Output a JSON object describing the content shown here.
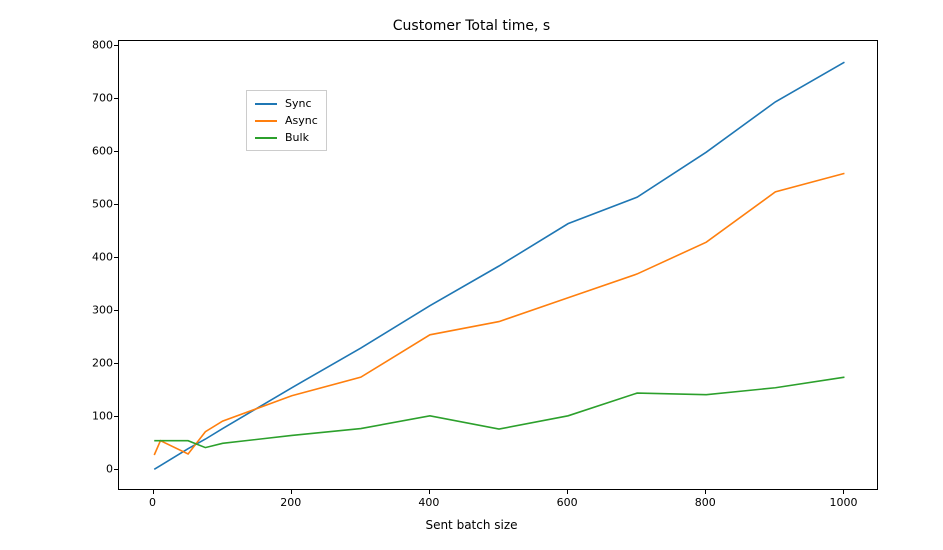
{
  "chart_data": {
    "type": "line",
    "title": "Customer Total time, s",
    "xlabel": "Sent batch size",
    "ylabel": "",
    "xlim": [
      -50,
      1050
    ],
    "ylim": [
      -40,
      810
    ],
    "x_ticks": [
      0,
      200,
      400,
      600,
      800,
      1000
    ],
    "y_ticks": [
      0,
      100,
      200,
      300,
      400,
      500,
      600,
      700,
      800
    ],
    "series": [
      {
        "name": "Sync",
        "color": "#1f77b4",
        "x": [
          1,
          10,
          50,
          75,
          100,
          200,
          300,
          400,
          500,
          600,
          700,
          800,
          900,
          1000
        ],
        "y": [
          1,
          8,
          40,
          58,
          78,
          155,
          230,
          310,
          385,
          465,
          515,
          600,
          695,
          770
        ]
      },
      {
        "name": "Async",
        "color": "#ff7f0e",
        "x": [
          1,
          10,
          50,
          75,
          100,
          200,
          300,
          400,
          500,
          600,
          700,
          800,
          900,
          1000
        ],
        "y": [
          28,
          55,
          30,
          72,
          92,
          140,
          175,
          255,
          280,
          325,
          370,
          430,
          525,
          560
        ]
      },
      {
        "name": "Bulk",
        "color": "#2ca02c",
        "x": [
          1,
          10,
          50,
          75,
          100,
          200,
          300,
          400,
          500,
          600,
          700,
          800,
          900,
          1000
        ],
        "y": [
          55,
          55,
          55,
          42,
          50,
          65,
          78,
          102,
          77,
          102,
          145,
          142,
          155,
          175
        ]
      }
    ],
    "legend_position": "upper left"
  }
}
